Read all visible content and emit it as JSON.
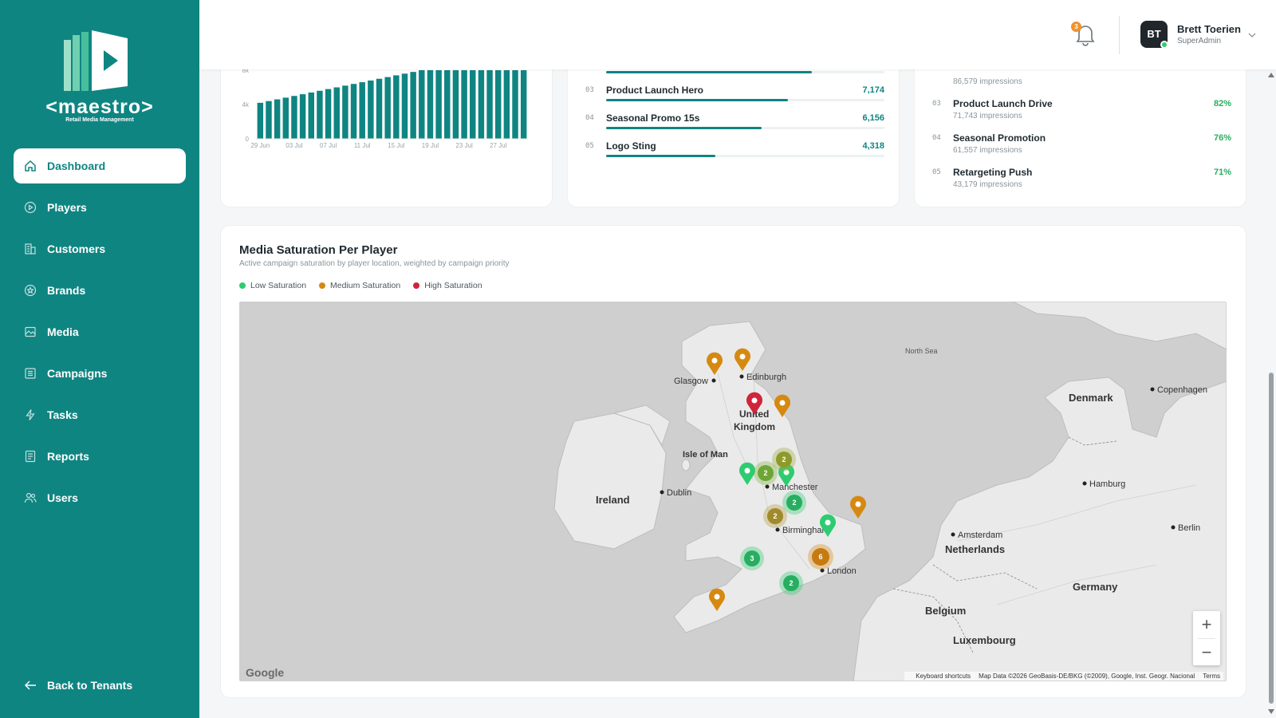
{
  "app": {
    "brand_name": "<maestro>",
    "brand_tagline": "Retail Media Management"
  },
  "sidebar": {
    "items": [
      {
        "label": "Dashboard",
        "icon": "home-icon",
        "active": true
      },
      {
        "label": "Players",
        "icon": "play-circle-icon",
        "active": false
      },
      {
        "label": "Customers",
        "icon": "building-icon",
        "active": false
      },
      {
        "label": "Brands",
        "icon": "star-circle-icon",
        "active": false
      },
      {
        "label": "Media",
        "icon": "image-icon",
        "active": false
      },
      {
        "label": "Campaigns",
        "icon": "list-icon",
        "active": false
      },
      {
        "label": "Tasks",
        "icon": "bolt-icon",
        "active": false
      },
      {
        "label": "Reports",
        "icon": "report-icon",
        "active": false
      },
      {
        "label": "Users",
        "icon": "users-icon",
        "active": false
      }
    ],
    "back_label": "Back to Tenants"
  },
  "header": {
    "notification_count": "3",
    "user_initials": "BT",
    "user_name": "Brett Toerien",
    "user_role": "SuperAdmin"
  },
  "chart_data": {
    "type": "bar",
    "color": "#0f8582",
    "y_ticks": [
      "0",
      "4k",
      "8k"
    ],
    "ylim": [
      0,
      8000
    ],
    "x_tick_labels": [
      "29 Jun",
      "03 Jul",
      "07 Jul",
      "11 Jul",
      "15 Jul",
      "19 Jul",
      "23 Jul",
      "27 Jul"
    ],
    "values": [
      4200,
      4400,
      4600,
      4800,
      5000,
      5200,
      5400,
      5600,
      5800,
      6000,
      6200,
      6400,
      6600,
      6800,
      7000,
      7200,
      7400,
      7600,
      7800,
      8000,
      8000,
      8000,
      8000,
      8000,
      8000,
      8000,
      8000,
      8000,
      8000,
      8000,
      8000,
      8000
    ]
  },
  "top_media": {
    "max": 10000,
    "partial_top_fill": 0.74,
    "rows": [
      {
        "rank": "03",
        "name": "Product Launch Hero",
        "value": "7,174",
        "fill": 0.652
      },
      {
        "rank": "04",
        "name": "Seasonal Promo 15s",
        "value": "6,156",
        "fill": 0.56
      },
      {
        "rank": "05",
        "name": "Logo Sting",
        "value": "4,318",
        "fill": 0.392
      }
    ]
  },
  "top_campaigns": {
    "partial_top_sub": "86,579 impressions",
    "rows": [
      {
        "rank": "03",
        "name": "Product Launch Drive",
        "sub": "71,743 impressions",
        "pct": "82%"
      },
      {
        "rank": "04",
        "name": "Seasonal Promotion",
        "sub": "61,557 impressions",
        "pct": "76%"
      },
      {
        "rank": "05",
        "name": "Retargeting Push",
        "sub": "43,179 impressions",
        "pct": "71%"
      }
    ]
  },
  "map_section": {
    "title": "Media Saturation Per Player",
    "subtitle": "Active campaign saturation by player location, weighted by campaign priority",
    "legend": [
      {
        "label": "Low Saturation",
        "color": "#2ecc71"
      },
      {
        "label": "Medium Saturation",
        "color": "#d68910"
      },
      {
        "label": "High Saturation",
        "color": "#d0243a"
      }
    ],
    "labels": {
      "north_sea": "North Sea",
      "denmark": "Denmark",
      "copenhagen": "Copenhagen",
      "glasgow": "Glasgow",
      "edinburgh": "Edinburgh",
      "united": "United",
      "kingdom": "Kingdom",
      "isle_of_man": "Isle of Man",
      "ireland": "Ireland",
      "dublin": "Dublin",
      "manchester": "Manchester",
      "birmingham": "Birmingham",
      "london": "London",
      "hamburg": "Hamburg",
      "amsterdam": "Amsterdam",
      "netherlands": "Netherlands",
      "berlin": "Berlin",
      "germany": "Germany",
      "belgium": "Belgium",
      "luxembourg": "Luxembourg"
    },
    "clusters": [
      "2",
      "2",
      "2",
      "2",
      "3",
      "6",
      "2"
    ],
    "zoom_in": "+",
    "zoom_out": "−",
    "google": "Google",
    "attribution": {
      "shortcuts": "Keyboard shortcuts",
      "data": "Map Data ©2026 GeoBasis-DE/BKG (©2009), Google, Inst. Geogr. Nacional",
      "terms": "Terms"
    }
  }
}
